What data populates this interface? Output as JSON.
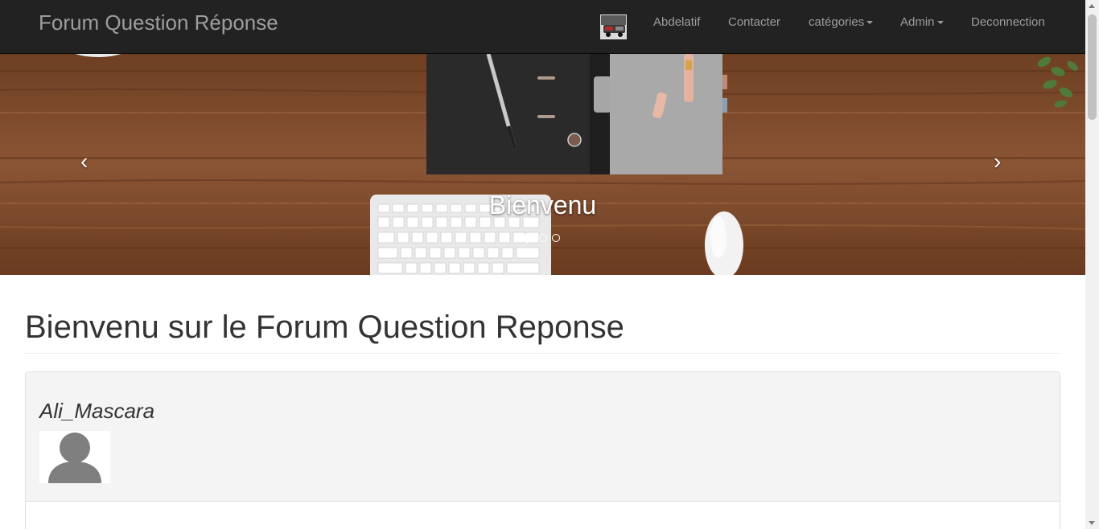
{
  "navbar": {
    "brand": "Forum Question Réponse",
    "user_name": "Abdelatif",
    "contact": "Contacter",
    "categories": "catégories",
    "admin": "Admin",
    "logout": "Deconnection"
  },
  "carousel": {
    "caption": "Bienvenu",
    "prev_label": "‹",
    "next_label": "›",
    "active_index": 1,
    "slide_count": 3
  },
  "main": {
    "heading": "Bienvenu sur le Forum Question Reponse",
    "post": {
      "author": "Ali_Mascara"
    }
  },
  "colors": {
    "navbar_bg": "#222222",
    "navbar_text": "#9d9d9d",
    "panel_heading_bg": "#f4f4f4"
  }
}
